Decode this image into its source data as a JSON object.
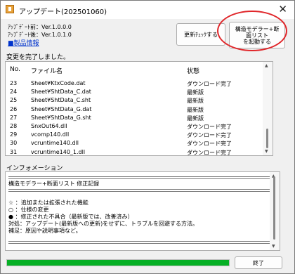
{
  "window": {
    "title": "アップデート(202501060)"
  },
  "versions": {
    "before": "ｱｯﾌﾟﾃﾞｰﾄ前：Ver.1.0.0.0",
    "after": "ｱｯﾌﾟﾃﾞｰﾄ後：Ver.1.0.1.0"
  },
  "product_link": "■製品情報",
  "buttons": {
    "check": "更新ﾁｪｯｸする",
    "launch_lines": [
      "構造モデラー+断",
      "面リスト",
      "を起動する"
    ],
    "exit": "終了"
  },
  "status_message": "変更を完了しました。",
  "table": {
    "headers": [
      "No.",
      "ファイル名",
      "状態"
    ],
    "rows": [
      [
        "23",
        "Sheet¥KtxCode.dat",
        "ダウンロード完了"
      ],
      [
        "24",
        "Sheet¥ShtData_C.dat",
        "最新版"
      ],
      [
        "25",
        "Sheet¥ShtData_C.sht",
        "最新版"
      ],
      [
        "26",
        "Sheet¥ShtData_G.dat",
        "最新版"
      ],
      [
        "27",
        "Sheet¥ShtData_G.sht",
        "最新版"
      ],
      [
        "28",
        "SnxOut64.dll",
        "ダウンロード完了"
      ],
      [
        "29",
        "vcomp140.dll",
        "ダウンロード完了"
      ],
      [
        "30",
        "vcruntime140.dll",
        "ダウンロード完了"
      ],
      [
        "31",
        "vcruntime140_1.dll",
        "ダウンロード完了"
      ]
    ]
  },
  "info": {
    "label": "インフォメーション",
    "title_line": "構造モデラー+断面リスト 修正記録",
    "legend": [
      "☆ ：追加または拡張された機能",
      "○ ：仕様の変更",
      "● ：修正された不具合（最新版では、改善済み）",
      "対処：アップデート(最新版への更新)をせずに、トラブルを回避する方法。",
      "補足：原因や説明事項など。"
    ]
  },
  "progress": {
    "fraction": 1.0,
    "color": "#06b025"
  }
}
